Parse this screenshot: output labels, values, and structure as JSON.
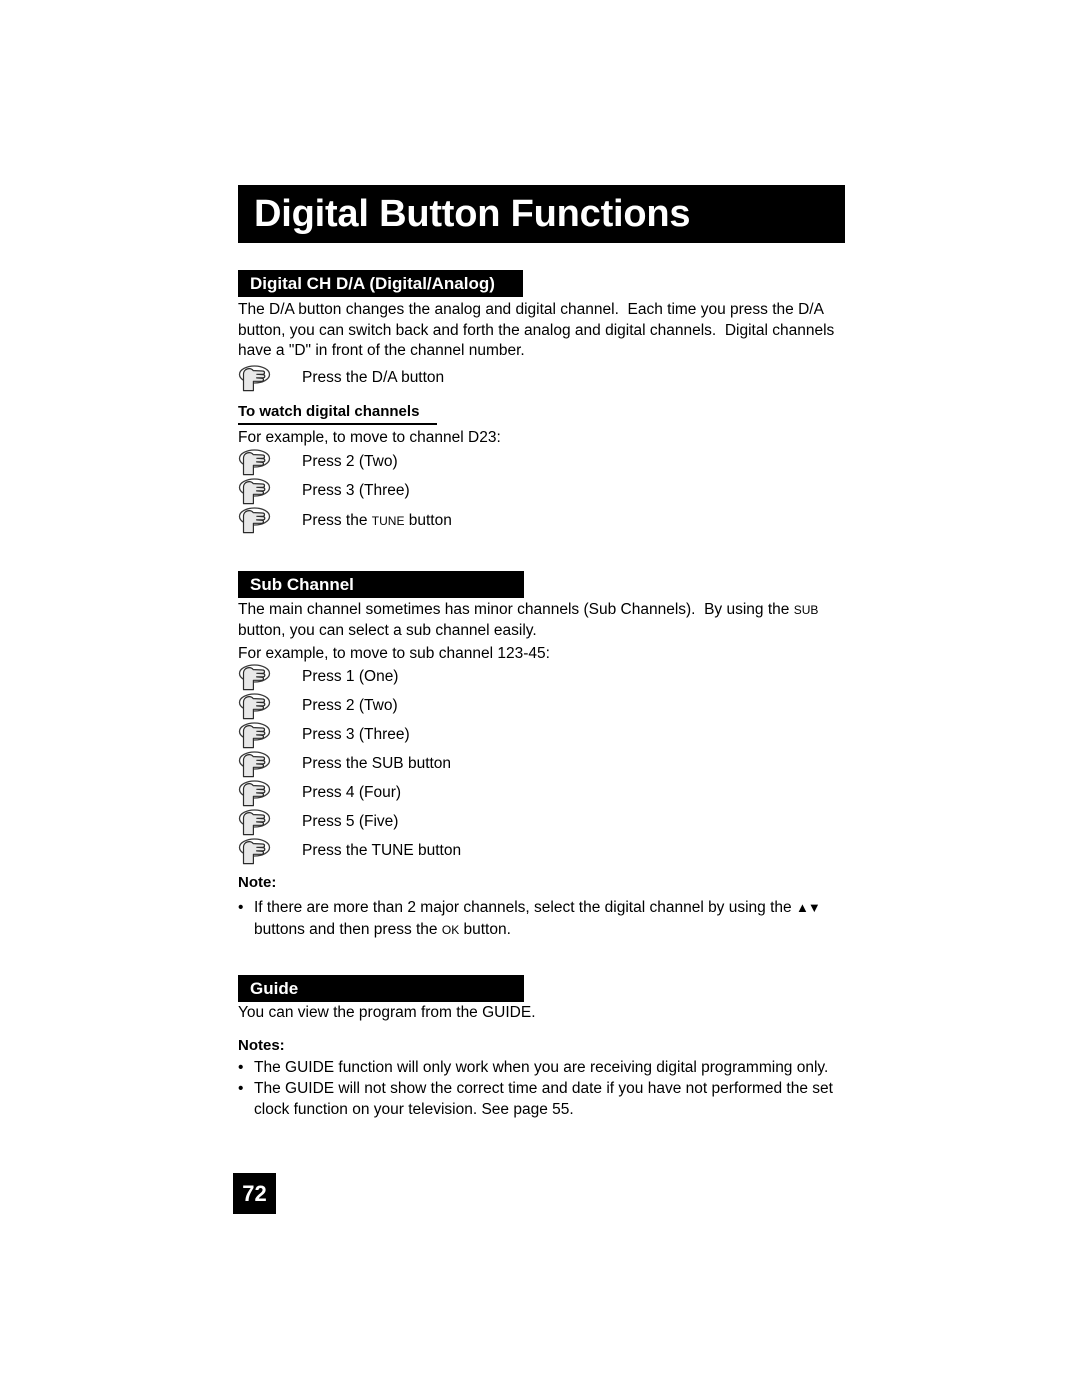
{
  "page": {
    "title": "Digital Button Functions",
    "number": "72",
    "background_color": "#ffffff",
    "accent_color": "#000000"
  },
  "sections": [
    {
      "id": "digital-ch-da",
      "header": "Digital CH D/A (Digital/Analog)",
      "paragraph": "The D/A button changes the analog and digital channel.  Each time you press the D/A button, you can switch back and forth the analog and digital channels.  Digital channels have a \"D\" in front of the channel number.",
      "first_step": "Press the D/A button",
      "subhead": "To watch digital channels",
      "example_intro": "For example, to move to channel D23:",
      "steps": [
        {
          "prefix": "Press 2 (Two)",
          "smallcaps": "",
          "suffix": ""
        },
        {
          "prefix": "Press 3 (Three)",
          "smallcaps": "",
          "suffix": ""
        },
        {
          "prefix": "Press the ",
          "smallcaps": "TUNE",
          "suffix": " button"
        }
      ]
    },
    {
      "id": "sub-channel",
      "header": "Sub Channel",
      "paragraph_part1": "The main channel sometimes has minor channels (Sub Channels).  By using the ",
      "paragraph_smallcaps": "SUB",
      "paragraph_part2": " button, you can select a sub channel easily.",
      "example_intro": "For example, to move to sub channel 123-45:",
      "steps": [
        "Press 1 (One)",
        "Press 2 (Two)",
        "Press 3 (Three)",
        "Press the SUB button",
        "Press 4 (Four)",
        "Press 5 (Five)",
        "Press the TUNE button"
      ],
      "note_title": "Note:",
      "note_bullets": [
        {
          "part1": "If there are more than 2 major channels, select the digital channel by using the ",
          "glyph": "▲▼",
          "part2": " buttons and then press the ",
          "smallcaps": "OK",
          "part3": " button."
        }
      ]
    },
    {
      "id": "guide",
      "header": "Guide",
      "paragraph": "You can view the program from the GUIDE.",
      "notes_title": "Notes:",
      "notes_bullets": [
        "The GUIDE function will only work when you are receiving digital programming only.",
        "The GUIDE will not show the correct time and date if you have not performed the set clock function on your television.  See page 55."
      ]
    }
  ],
  "icons": {
    "hand_press": "hand-press-icon",
    "bullet": "•"
  }
}
